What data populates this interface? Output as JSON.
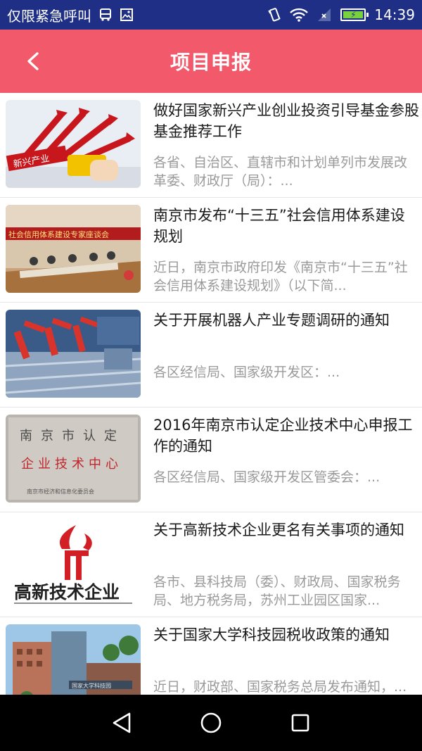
{
  "status_bar": {
    "carrier_text": "仅限紧急呼叫",
    "time": "14:39"
  },
  "app_bar": {
    "title": "项目申报"
  },
  "articles": [
    {
      "title": "做好国家新兴产业创业投资引导基金参股基金推荐工作",
      "summary": "各省、自治区、直辖市和计划单列市发展改革委、财政厅（局）：...",
      "thumb_text": "新兴产业"
    },
    {
      "title": "南京市发布“十三五”社会信用体系建设规划",
      "summary": "近日，南京市政府印发《南京市“十三五”社会信用体系建设规划》（以下简...",
      "thumb_text": "社会信用体系建设专家座谈会"
    },
    {
      "title": "关于开展机器人产业专题调研的通知",
      "summary": "各区经信局、国家级开发区：...",
      "thumb_text": ""
    },
    {
      "title": "2016年南京市认定企业技术中心申报工作的通知",
      "summary": "各区经信局、国家级开发区管委会：...",
      "thumb_text_top": "南京市认定",
      "thumb_text_mid": "企业技术中心",
      "thumb_text_bottom": "南京市经济和信息化委员会"
    },
    {
      "title": "关于高新技术企业更名有关事项的通知",
      "summary": "各市、县科技局（委）、财政局、国家税务局、地方税务局，苏州工业园区国家...",
      "thumb_text": "高新技术企业"
    },
    {
      "title": "关于国家大学科技园税收政策的通知",
      "summary": "近日，财政部、国家税务总局发布通知，...",
      "thumb_text": "国家大学科技园"
    }
  ],
  "colors": {
    "status_bar": "#1f2f86",
    "app_bar": "#f2596b",
    "title_text": "#1a1a1a",
    "summary_text": "#9a9a9a"
  }
}
